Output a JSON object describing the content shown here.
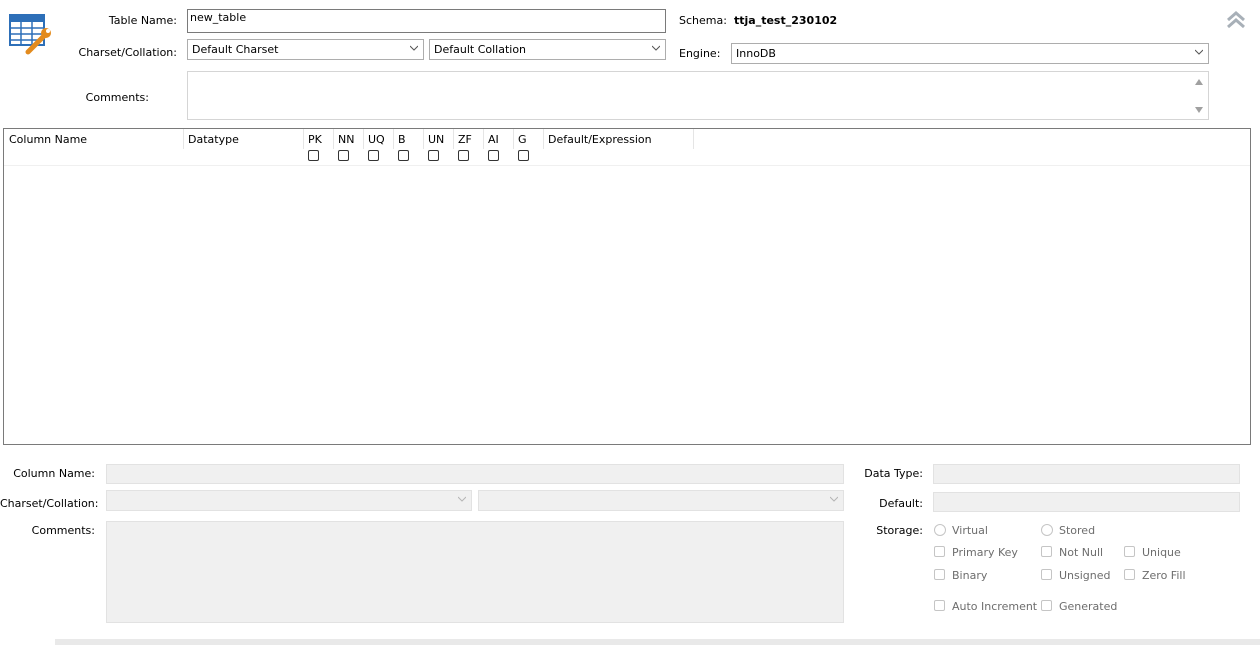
{
  "table": {
    "name_label": "Table Name:",
    "name_value": "new_table",
    "charset_label": "Charset/Collation:",
    "charset_value": "Default Charset",
    "collation_value": "Default Collation",
    "comments_label": "Comments:",
    "schema_label": "Schema:",
    "schema_value": "ttja_test_230102",
    "engine_label": "Engine:",
    "engine_value": "InnoDB"
  },
  "grid": {
    "columns": [
      "Column Name",
      "Datatype",
      "PK",
      "NN",
      "UQ",
      "B",
      "UN",
      "ZF",
      "AI",
      "G",
      "Default/Expression"
    ]
  },
  "details": {
    "column_name_label": "Column Name:",
    "charset_label": "Charset/Collation:",
    "comments_label": "Comments:",
    "data_type_label": "Data Type:",
    "default_label": "Default:",
    "storage_label": "Storage:",
    "options": {
      "virtual": "Virtual",
      "stored": "Stored",
      "primary_key": "Primary Key",
      "not_null": "Not Null",
      "unique": "Unique",
      "binary": "Binary",
      "unsigned": "Unsigned",
      "zero_fill": "Zero Fill",
      "auto_increment": "Auto Increment",
      "generated": "Generated"
    }
  },
  "icons": {
    "table_editor": "table-wrench-icon",
    "collapse": "double-chevron-up-icon"
  },
  "colors": {
    "icon_blue": "#2d6fb8",
    "icon_orange": "#e38b1e",
    "disabled_bg": "#f0f0f0",
    "border": "#7a7a7a"
  }
}
